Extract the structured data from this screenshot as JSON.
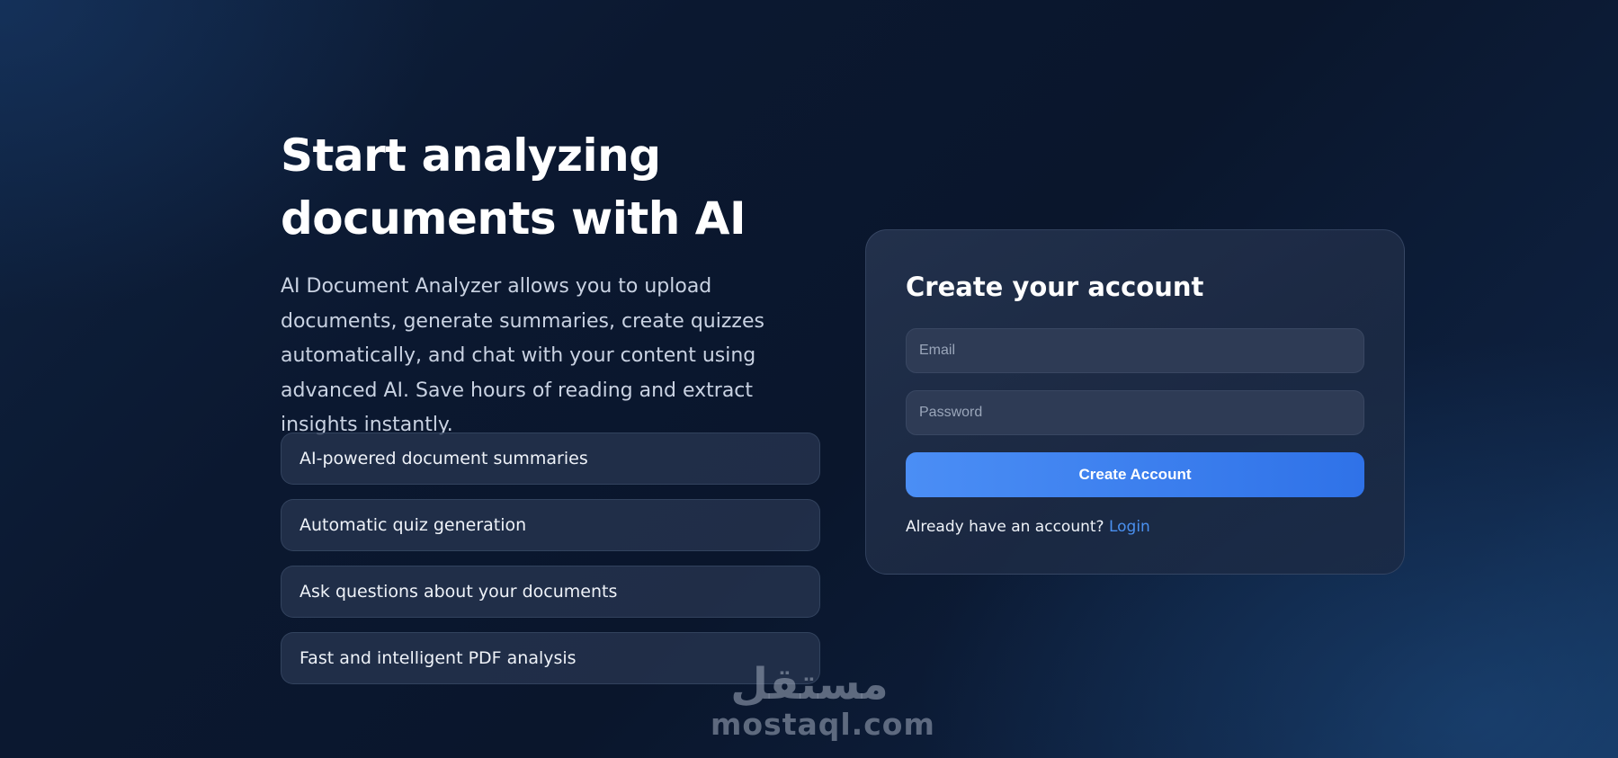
{
  "hero": {
    "title_line1": "Start analyzing",
    "title_line2": "documents with AI",
    "description": "AI Document Analyzer allows you to upload documents, generate summaries, create quizzes automatically, and chat with your content using advanced AI. Save hours of reading and extract insights instantly."
  },
  "features": [
    {
      "label": "AI-powered document summaries"
    },
    {
      "label": "Automatic quiz generation"
    },
    {
      "label": "Ask questions about your documents"
    },
    {
      "label": "Fast and intelligent PDF analysis"
    }
  ],
  "signup": {
    "title": "Create your account",
    "email_placeholder": "Email",
    "email_value": "",
    "password_placeholder": "Password",
    "password_value": "",
    "submit_label": "Create Account",
    "login_prompt": "Already have an account?",
    "login_link": "Login"
  },
  "watermark": {
    "arabic": "مستقل",
    "latin": "mostaql.com"
  },
  "colors": {
    "accent": "#3b82f6",
    "link": "#4a90f0",
    "background": "#0b1830"
  }
}
